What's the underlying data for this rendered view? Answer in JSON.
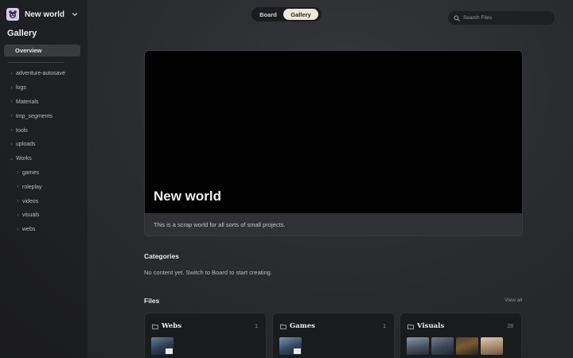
{
  "world": {
    "title": "New world",
    "logo_icon": "bear-icon"
  },
  "sidebar": {
    "heading": "Gallery",
    "overview_label": "Overview",
    "items": [
      {
        "label": "adventure-autosave",
        "level": 0
      },
      {
        "label": "logs",
        "level": 0
      },
      {
        "label": "Materials",
        "level": 0
      },
      {
        "label": "tmp_segments",
        "level": 0
      },
      {
        "label": "tools",
        "level": 0
      },
      {
        "label": "uploads",
        "level": 0
      },
      {
        "label": "Works",
        "level": 0,
        "expanded": true
      },
      {
        "label": "games",
        "level": 1
      },
      {
        "label": "roleplay",
        "level": 1
      },
      {
        "label": "videos",
        "level": 1
      },
      {
        "label": "visuals",
        "level": 1
      },
      {
        "label": "webs",
        "level": 1
      }
    ]
  },
  "view_toggle": {
    "board_label": "Board",
    "gallery_label": "Gallery",
    "active": "Gallery"
  },
  "search": {
    "placeholder": "Search Files",
    "value": ""
  },
  "hero": {
    "title": "New world",
    "description": "This is a scrap world for all sorts of small projects."
  },
  "categories": {
    "heading": "Categories",
    "empty_text": "No content yet. Switch to Board to start creating."
  },
  "files": {
    "heading": "Files",
    "view_all_label": "View all",
    "cards": [
      {
        "name": "Webs",
        "count": "1",
        "thumbs": 1
      },
      {
        "name": "Games",
        "count": "1",
        "thumbs": 1
      },
      {
        "name": "Visuals",
        "count": "28",
        "thumbs": 4
      }
    ]
  },
  "colors": {
    "background": "#2a2c2f",
    "sidebar_active": "#3a3b3e",
    "toggle_active": "#efe7d8",
    "card": "#1a1b1d"
  }
}
